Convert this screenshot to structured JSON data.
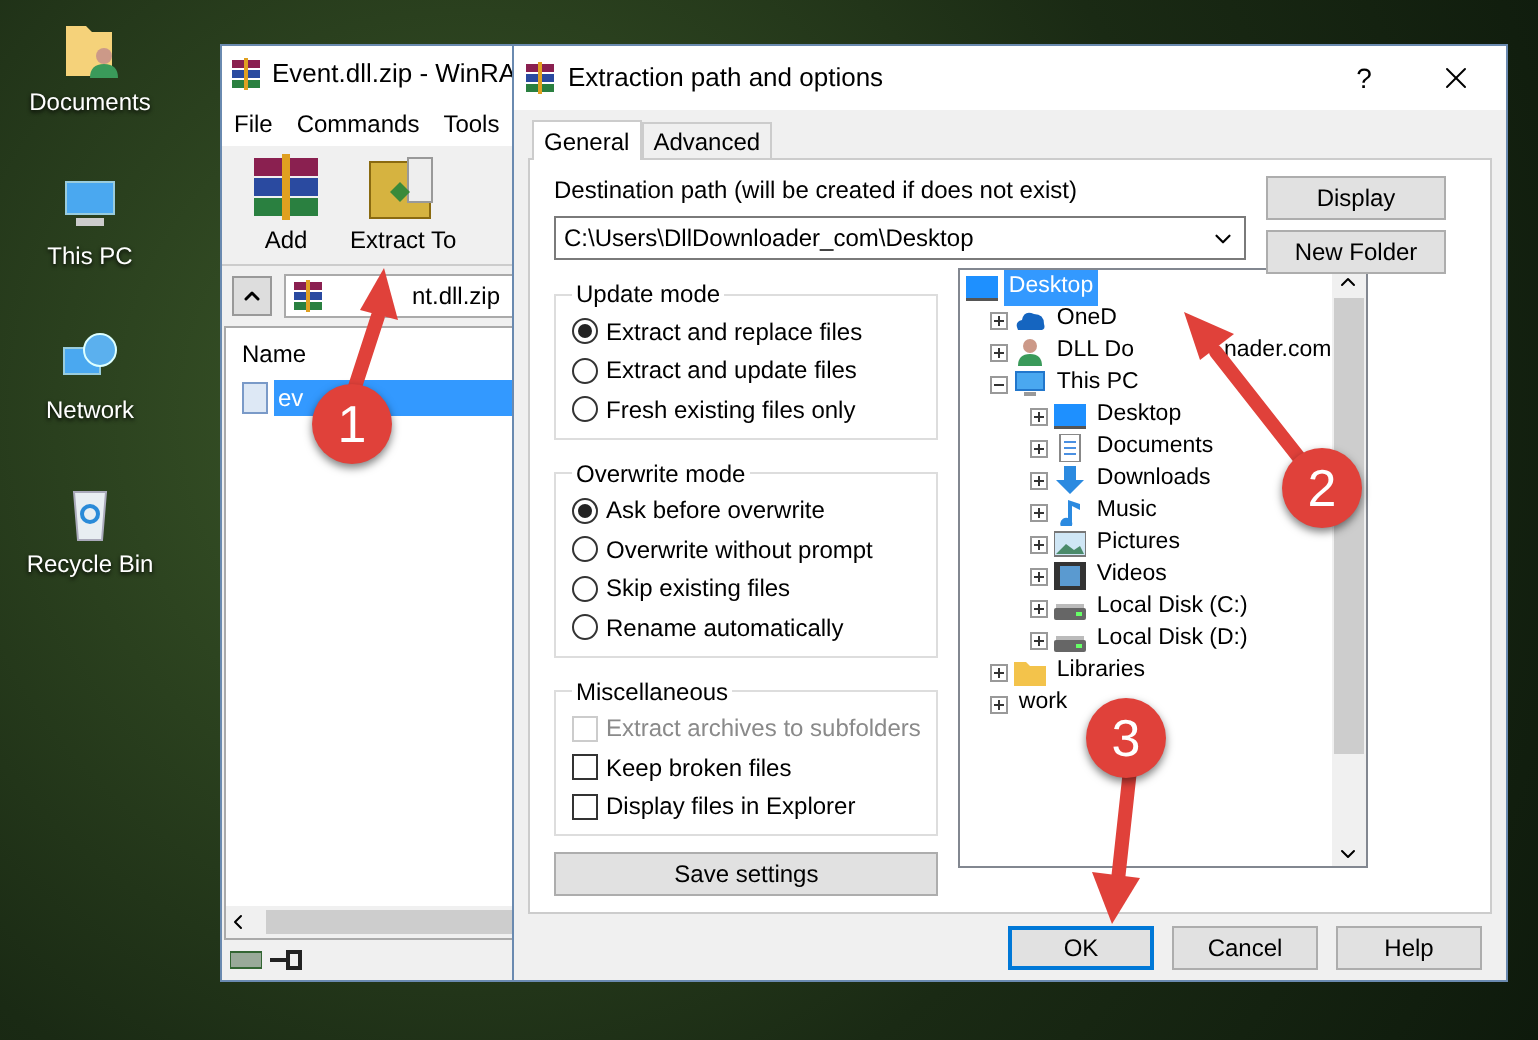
{
  "desktop_icons": [
    {
      "label": "Documents",
      "kind": "documents"
    },
    {
      "label": "This PC",
      "kind": "pc"
    },
    {
      "label": "Network",
      "kind": "network"
    },
    {
      "label": "Recycle Bin",
      "kind": "recycle"
    }
  ],
  "winrar": {
    "title": "Event.dll.zip - WinRA",
    "menu": [
      "File",
      "Commands",
      "Tools"
    ],
    "toolbar": [
      {
        "label": "Add",
        "kind": "add"
      },
      {
        "label": "Extract To",
        "kind": "extract"
      }
    ],
    "path": "nt.dll.zip",
    "list_header": "Name",
    "files": [
      {
        "name": "ev",
        "selected": true
      }
    ]
  },
  "dialog": {
    "title": "Extraction path and options",
    "help": "?",
    "tabs": [
      {
        "label": "General",
        "selected": true
      },
      {
        "label": "Advanced",
        "selected": false
      }
    ],
    "destination_label": "Destination path (will be created if does not exist)",
    "destination_path": "C:\\Users\\DllDownloader_com\\Desktop",
    "side_buttons": [
      "Display",
      "New Folder"
    ],
    "groups": [
      {
        "title": "Update mode",
        "options": [
          {
            "kind": "radio",
            "label": "Extract and replace files",
            "selected": true,
            "disabled": false
          },
          {
            "kind": "radio",
            "label": "Extract and update files",
            "selected": false,
            "disabled": false
          },
          {
            "kind": "radio",
            "label": "Fresh existing files only",
            "selected": false,
            "disabled": false
          }
        ]
      },
      {
        "title": "Overwrite mode",
        "options": [
          {
            "kind": "radio",
            "label": "Ask before overwrite",
            "selected": true,
            "disabled": false
          },
          {
            "kind": "radio",
            "label": "Overwrite without prompt",
            "selected": false,
            "disabled": false
          },
          {
            "kind": "radio",
            "label": "Skip existing files",
            "selected": false,
            "disabled": false
          },
          {
            "kind": "radio",
            "label": "Rename automatically",
            "selected": false,
            "disabled": false
          }
        ]
      },
      {
        "title": "Miscellaneous",
        "options": [
          {
            "kind": "checkbox",
            "label": "Extract archives to subfolders",
            "checked": false,
            "disabled": true
          },
          {
            "kind": "checkbox",
            "label": "Keep broken files",
            "checked": false,
            "disabled": false
          },
          {
            "kind": "checkbox",
            "label": "Display files in Explorer",
            "checked": false,
            "disabled": false
          }
        ]
      }
    ],
    "save_button": "Save settings",
    "tree": [
      {
        "label": "Desktop",
        "kind": "monitor",
        "selected": true,
        "children": [
          {
            "label": "OneD",
            "kind": "cloud",
            "selected": false,
            "expanded": false
          },
          {
            "label": "DLL Do",
            "label_2": "nader.com",
            "kind": "user",
            "selected": false,
            "expanded": false
          },
          {
            "label": "This PC",
            "kind": "pc",
            "selected": false,
            "expanded": true,
            "children": [
              {
                "label": "Desktop",
                "kind": "monitor",
                "selected": false,
                "expanded": false
              },
              {
                "label": "Documents",
                "kind": "document",
                "selected": false,
                "expanded": false
              },
              {
                "label": "Downloads",
                "kind": "download",
                "selected": false,
                "expanded": false
              },
              {
                "label": "Music",
                "kind": "music",
                "selected": false,
                "expanded": false
              },
              {
                "label": "Pictures",
                "kind": "pictures",
                "selected": false,
                "expanded": false
              },
              {
                "label": "Videos",
                "kind": "videos",
                "selected": false,
                "expanded": false
              },
              {
                "label": "Local Disk (C:)",
                "kind": "disk",
                "selected": false,
                "expanded": false
              },
              {
                "label": "Local Disk (D:)",
                "kind": "disk",
                "selected": false,
                "expanded": false
              }
            ]
          },
          {
            "label": "Libraries",
            "kind": "folder",
            "selected": false,
            "expanded": false
          },
          {
            "label": "work",
            "kind": "none",
            "selected": false,
            "expanded": false
          }
        ]
      }
    ],
    "buttons": [
      {
        "label": "OK",
        "default": true
      },
      {
        "label": "Cancel",
        "default": false
      },
      {
        "label": "Help",
        "default": false
      }
    ]
  },
  "annotations": [
    {
      "number": "1"
    },
    {
      "number": "2"
    },
    {
      "number": "3"
    }
  ]
}
